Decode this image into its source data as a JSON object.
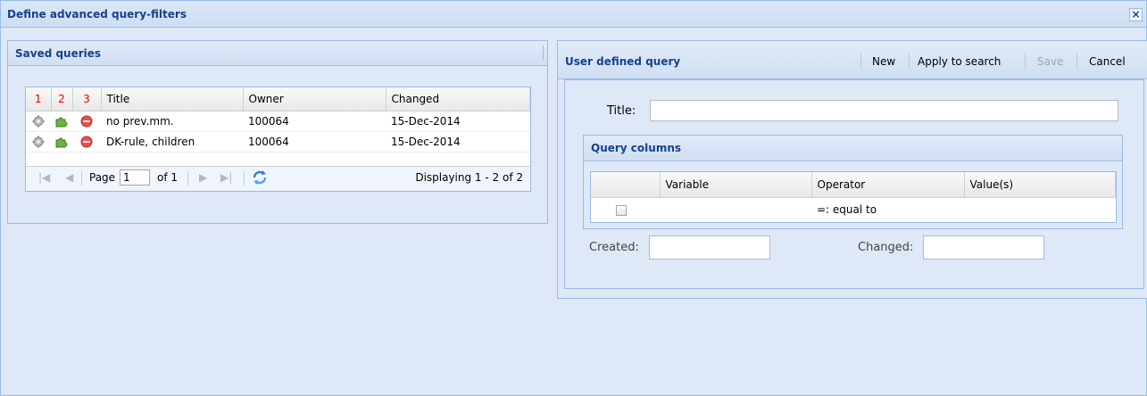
{
  "window": {
    "title": "Define advanced query-filters",
    "close_symbol": "×"
  },
  "saved": {
    "title": "Saved queries",
    "columns": {
      "c1": "1",
      "c2": "2",
      "c3": "3",
      "title": "Title",
      "owner": "Owner",
      "changed": "Changed"
    },
    "rows": [
      {
        "title": "no prev.mm.",
        "owner": "100064",
        "changed": "15-Dec-2014"
      },
      {
        "title": "DK-rule, children",
        "owner": "100064",
        "changed": "15-Dec-2014"
      }
    ],
    "pager": {
      "page_label": "Page",
      "page": "1",
      "of": "of 1",
      "display": "Displaying 1 - 2 of 2"
    }
  },
  "query": {
    "title": "User defined query",
    "toolbar": {
      "new": "New",
      "apply": "Apply to search",
      "save": "Save",
      "cancel": "Cancel"
    },
    "title_label": "Title:",
    "title_value": "",
    "columns_title": "Query columns",
    "columns": {
      "variable": "Variable",
      "operator": "Operator",
      "values": "Value(s)"
    },
    "row": {
      "operator": "=: equal to"
    },
    "created_label": "Created:",
    "changed_label": "Changed:",
    "created_value": "",
    "changed_value": ""
  },
  "colors": {
    "header_text": "#15428b",
    "border": "#99bbe8",
    "panel_bg": "#dfe8f6",
    "row_numbers": "#e00000"
  }
}
